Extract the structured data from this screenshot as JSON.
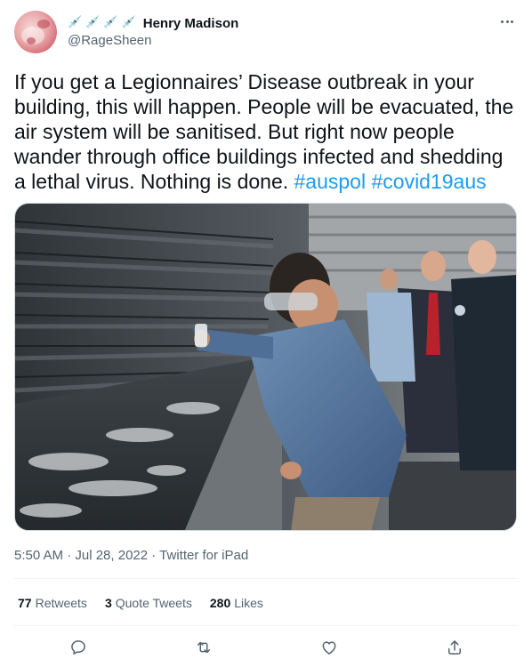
{
  "author": {
    "display_name": "Henry Madison",
    "handle": "@RageSheen",
    "name_emojis": [
      "💉",
      "💉",
      "💉",
      "💉"
    ]
  },
  "tweet": {
    "text": "If you get a Legionnaires’ Disease outbreak in your building, this will happen. People will be evacuated, the air system will be sanitised. But right now people wander through office buildings infected and shedding a lethal virus. Nothing is done.",
    "hashtags": [
      "#auspol",
      "#covid19aus"
    ],
    "image_alt": "Person in goggles and respirator taking a water sample from a cooling tower while officials watch"
  },
  "meta": {
    "timestamp": "5:50 AM · Jul 28, 2022",
    "separator": " · ",
    "source": "Twitter for iPad"
  },
  "stats": {
    "retweets_count": "77",
    "retweets_label": "Retweets",
    "quotes_count": "3",
    "quotes_label": "Quote Tweets",
    "likes_count": "280",
    "likes_label": "Likes"
  },
  "icons": {
    "more": "more-options-icon",
    "reply": "reply-icon",
    "retweet": "retweet-icon",
    "like": "heart-icon",
    "share": "share-icon"
  },
  "colors": {
    "link": "#1d9bf0",
    "secondary_text": "#536471",
    "primary_text": "#0f1419"
  }
}
